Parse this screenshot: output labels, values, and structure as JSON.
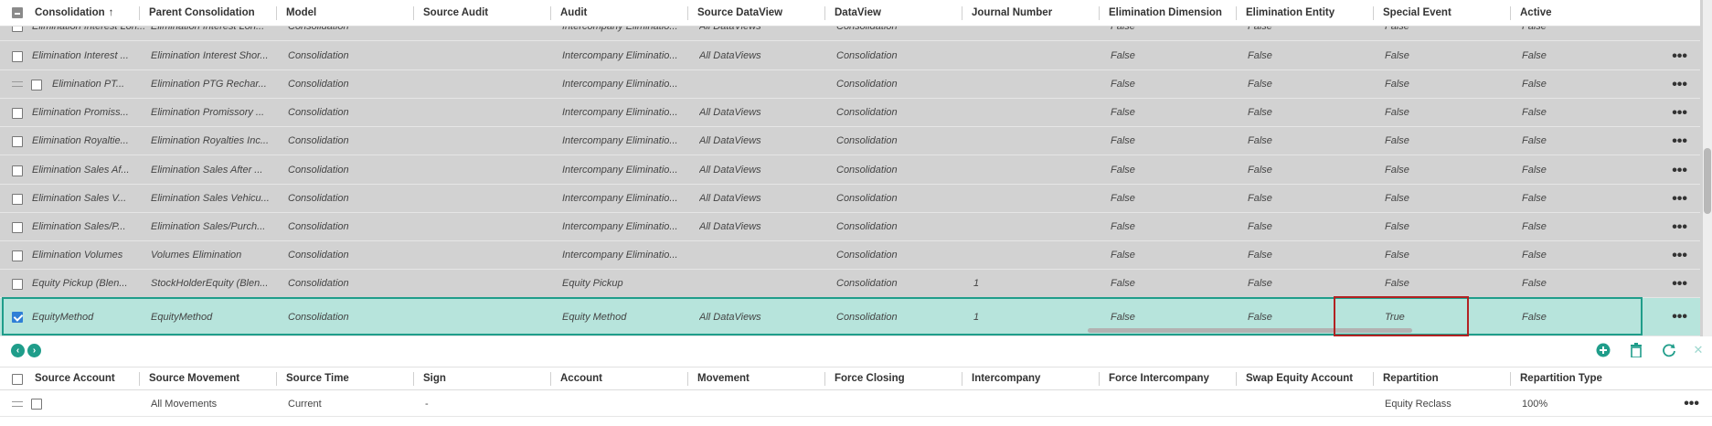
{
  "top_grid": {
    "columns": [
      "Consolidation",
      "Parent Consolidation",
      "Model",
      "Source Audit",
      "Audit",
      "Source DataView",
      "DataView",
      "Journal Number",
      "Elimination Dimension",
      "Elimination Entity",
      "Special Event",
      "Active"
    ],
    "sort_indicator": "↑",
    "rows": [
      [
        "Elimination Interest Lon...",
        "Elimination Interest Lon...",
        "Consolidation",
        "",
        "Intercompany Eliminatio...",
        "All DataViews",
        "Consolidation",
        "",
        "False",
        "False",
        "False",
        "False"
      ],
      [
        "Elimination Interest ...",
        "Elimination Interest Shor...",
        "Consolidation",
        "",
        "Intercompany Eliminatio...",
        "All DataViews",
        "Consolidation",
        "",
        "False",
        "False",
        "False",
        "False"
      ],
      [
        "Elimination PT...",
        "Elimination PTG Rechar...",
        "Consolidation",
        "",
        "Intercompany Eliminatio...",
        "",
        "Consolidation",
        "",
        "False",
        "False",
        "False",
        "False"
      ],
      [
        "Elimination Promiss...",
        "Elimination Promissory ...",
        "Consolidation",
        "",
        "Intercompany Eliminatio...",
        "All DataViews",
        "Consolidation",
        "",
        "False",
        "False",
        "False",
        "False"
      ],
      [
        "Elimination Royaltie...",
        "Elimination Royalties Inc...",
        "Consolidation",
        "",
        "Intercompany Eliminatio...",
        "All DataViews",
        "Consolidation",
        "",
        "False",
        "False",
        "False",
        "False"
      ],
      [
        "Elimination Sales Af...",
        "Elimination Sales After ...",
        "Consolidation",
        "",
        "Intercompany Eliminatio...",
        "All DataViews",
        "Consolidation",
        "",
        "False",
        "False",
        "False",
        "False"
      ],
      [
        "Elimination Sales V...",
        "Elimination Sales Vehicu...",
        "Consolidation",
        "",
        "Intercompany Eliminatio...",
        "All DataViews",
        "Consolidation",
        "",
        "False",
        "False",
        "False",
        "False"
      ],
      [
        "Elimination Sales/P...",
        "Elimination Sales/Purch...",
        "Consolidation",
        "",
        "Intercompany Eliminatio...",
        "All DataViews",
        "Consolidation",
        "",
        "False",
        "False",
        "False",
        "False"
      ],
      [
        "Elimination Volumes",
        "Volumes Elimination",
        "Consolidation",
        "",
        "Intercompany Eliminatio...",
        "",
        "Consolidation",
        "",
        "False",
        "False",
        "False",
        "False"
      ],
      [
        "Equity Pickup (Blen...",
        "StockHolderEquity (Blen...",
        "Consolidation",
        "",
        "Equity Pickup",
        "",
        "Consolidation",
        "1",
        "False",
        "False",
        "False",
        "False"
      ],
      [
        "EquityMethod",
        "EquityMethod",
        "Consolidation",
        "",
        "Equity Method",
        "All DataViews",
        "Consolidation",
        "1",
        "False",
        "False",
        "True",
        "False"
      ]
    ]
  },
  "bottom_grid": {
    "columns": [
      "Source Account",
      "Source Movement",
      "Source Time",
      "Sign",
      "Account",
      "Movement",
      "Force Closing",
      "Intercompany",
      "Force Intercompany",
      "Swap Equity Account",
      "Repartition",
      "Repartition Type"
    ],
    "rows": [
      [
        "",
        "All Movements",
        "Current",
        "-",
        "",
        "",
        "",
        "",
        "",
        "",
        "Equity Reclass",
        "100%"
      ]
    ]
  },
  "nav": {
    "prev": "‹",
    "next": "›"
  },
  "toolbar": {
    "add": "+",
    "delete": "🗑",
    "refresh": "⟳",
    "close": "✕"
  },
  "more_glyph": "•••",
  "colors": {
    "accent": "#1f9d8a",
    "highlight": "#b22222",
    "selected_row": "#b7e4dc"
  }
}
